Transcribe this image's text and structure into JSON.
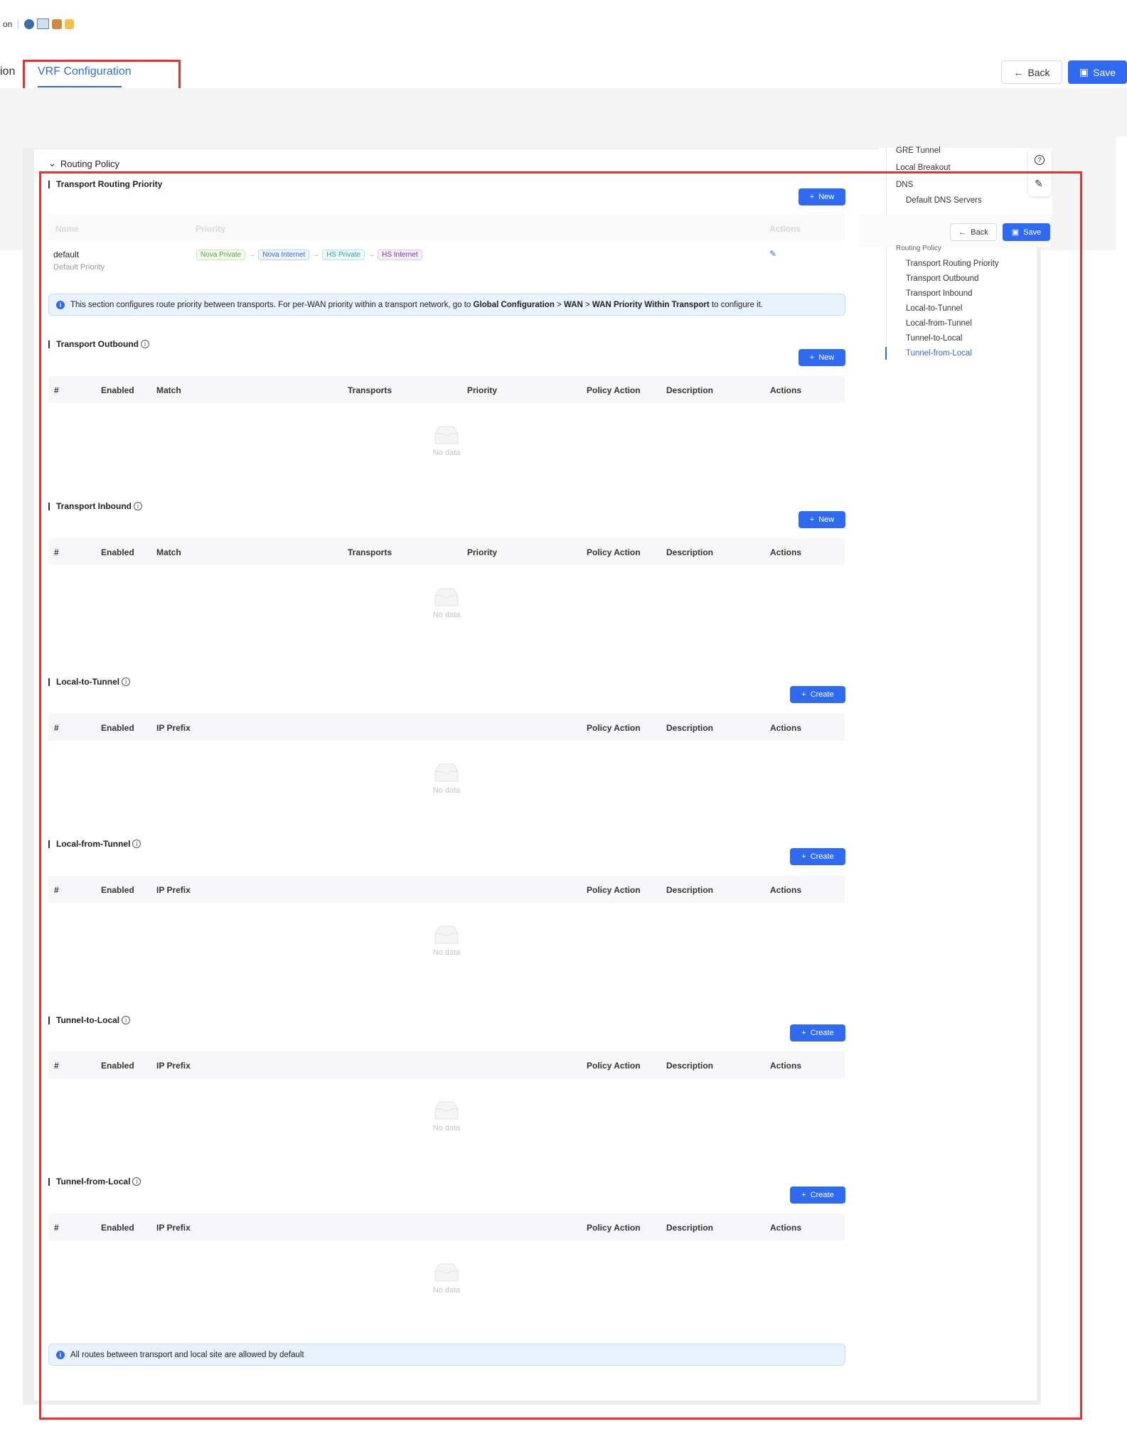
{
  "header": {
    "prev_tab_label": "ion",
    "active_tab_label": "VRF Configuration",
    "back_label": "Back",
    "save_label": "Save"
  },
  "section": {
    "title": "Routing Policy"
  },
  "transport_routing_priority": {
    "title": "Transport Routing Priority",
    "new_label": "New",
    "columns": [
      "Name",
      "Priority",
      "Actions"
    ],
    "row": {
      "name": "default",
      "subtitle": "Default Priority",
      "transports": [
        "Nova Private",
        "Nova Internet",
        "HS Private",
        "HS Internet"
      ],
      "arrow": "→"
    },
    "info_prefix": "This section configures route priority between transports. For per-WAN priority within a transport network, go to ",
    "info_link1": "Global Configuration",
    "info_sep1": " > ",
    "info_link2": "WAN",
    "info_sep2": " > ",
    "info_link3": "WAN Priority Within Transport",
    "info_suffix": " to configure it."
  },
  "transport_outbound": {
    "title": "Transport Outbound",
    "new_label": "New",
    "columns": [
      "#",
      "Enabled",
      "Match",
      "Transports",
      "Priority",
      "Policy Action",
      "Description",
      "Actions"
    ],
    "empty": "No data"
  },
  "transport_inbound": {
    "title": "Transport Inbound",
    "new_label": "New",
    "columns": [
      "#",
      "Enabled",
      "Match",
      "Transports",
      "Priority",
      "Policy Action",
      "Description",
      "Actions"
    ],
    "empty": "No data"
  },
  "local_to_tunnel": {
    "title": "Local-to-Tunnel",
    "create_label": "Create",
    "columns": [
      "#",
      "Enabled",
      "IP Prefix",
      "Policy Action",
      "Description",
      "Actions"
    ],
    "empty": "No data"
  },
  "local_from_tunnel": {
    "title": "Local-from-Tunnel",
    "create_label": "Create",
    "columns": [
      "#",
      "Enabled",
      "IP Prefix",
      "Policy Action",
      "Description",
      "Actions"
    ],
    "empty": "No data"
  },
  "tunnel_to_local": {
    "title": "Tunnel-to-Local",
    "create_label": "Create",
    "columns": [
      "#",
      "Enabled",
      "IP Prefix",
      "Policy Action",
      "Description",
      "Actions"
    ],
    "empty": "No data"
  },
  "tunnel_from_local": {
    "title": "Tunnel-from-Local",
    "create_label": "Create",
    "columns": [
      "#",
      "Enabled",
      "IP Prefix",
      "Policy Action",
      "Description",
      "Actions"
    ],
    "empty": "No data"
  },
  "footer_info": "All routes between transport and local site are allowed by default",
  "floating": {
    "back_label": "Back",
    "save_label": "Save"
  },
  "toc": {
    "items": [
      "GRE Tunnel",
      "Local Breakout",
      "DNS",
      "Default DNS Servers",
      "Routing Policy",
      "Transport Routing Priority",
      "Transport Outbound",
      "Transport Inbound",
      "Local-to-Tunnel",
      "Local-from-Tunnel",
      "Tunnel-to-Local",
      "Tunnel-from-Local"
    ],
    "active_index": 11
  },
  "colors": {
    "accent": "#2f6bf2",
    "highlight_box": "#e8322f",
    "tag_green": "#52a43a",
    "tag_blue": "#2f6bd8",
    "tag_cyan": "#2aa3a8",
    "tag_purple": "#7a2fa8"
  }
}
